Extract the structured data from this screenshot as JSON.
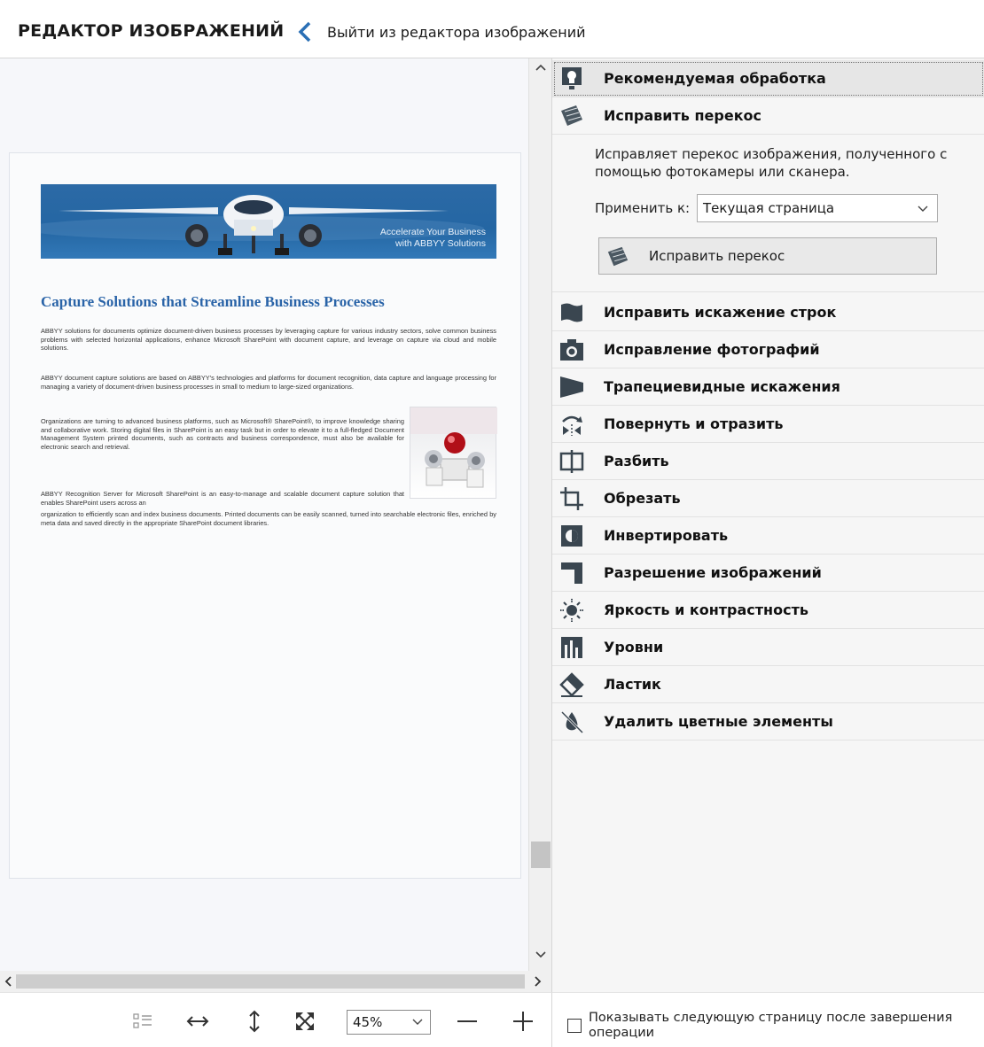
{
  "header": {
    "title": "РЕДАКТОР ИЗОБРАЖЕНИЙ",
    "back_label": "Выйти из редактора изображений"
  },
  "document": {
    "banner_line1": "Accelerate Your Business",
    "banner_line2": "with ABBYY Solutions",
    "title": "Capture Solutions that Streamline Business Processes",
    "p1": "ABBYY solutions for documents optimize document-driven business processes by leveraging capture for various industry sectors, solve common business problems with selected horizontal applications, enhance Microsoft SharePoint with document capture, and leverage on capture via cloud and mobile solutions.",
    "p2": "ABBYY document capture solutions are based on ABBYY's technologies and platforms for document recognition, data capture and language processing for managing a variety of document-driven business processes in small to medium to large-sized organizations.",
    "p3": "Organizations are turning to advanced business platforms, such as Microsoft® SharePoint®, to improve knowledge sharing and collaborative work. Storing digital files in SharePoint is an easy task but in order to elevate it to a full-fledged Document Management System printed documents, such as contracts and business correspondence, must also be available for electronic search and retrieval.",
    "p4a": "ABBYY Recognition Server for Microsoft SharePoint is an easy-to-manage and scalable document capture solution that enables SharePoint users across an",
    "p4b": "organization to efficiently scan and index business documents. Printed documents can be easily scanned, turned into searchable electronic files, enriched by meta data and saved directly in the appropriate SharePoint document libraries."
  },
  "toolbar": {
    "zoom_value": "45%"
  },
  "panel": {
    "recommended": "Рекомендуемая обработка",
    "deskew": "Исправить перекос",
    "deskew_description": "Исправляет перекос изображения, полученного с помощью фотокамеры или сканера.",
    "apply_to_label": "Применить к:",
    "apply_to_value": "Текущая страница",
    "deskew_button": "Исправить перекос",
    "items": [
      {
        "label": "Исправить искажение строк",
        "icon": "page-curl-icon"
      },
      {
        "label": "Исправление фотографий",
        "icon": "camera-icon"
      },
      {
        "label": "Трапециевидные искажения",
        "icon": "trapezoid-icon"
      },
      {
        "label": "Повернуть и отразить",
        "icon": "rotate-flip-icon"
      },
      {
        "label": "Разбить",
        "icon": "split-icon"
      },
      {
        "label": "Обрезать",
        "icon": "crop-icon"
      },
      {
        "label": "Инвертировать",
        "icon": "invert-icon"
      },
      {
        "label": "Разрешение изображений",
        "icon": "resolution-icon"
      },
      {
        "label": "Яркость и контрастность",
        "icon": "brightness-icon"
      },
      {
        "label": "Уровни",
        "icon": "levels-icon"
      },
      {
        "label": "Ластик",
        "icon": "eraser-icon"
      },
      {
        "label": "Удалить цветные элементы",
        "icon": "remove-color-icon"
      }
    ]
  },
  "footer": {
    "show_next_page_label": "Показывать следующую страницу после завершения операции"
  }
}
